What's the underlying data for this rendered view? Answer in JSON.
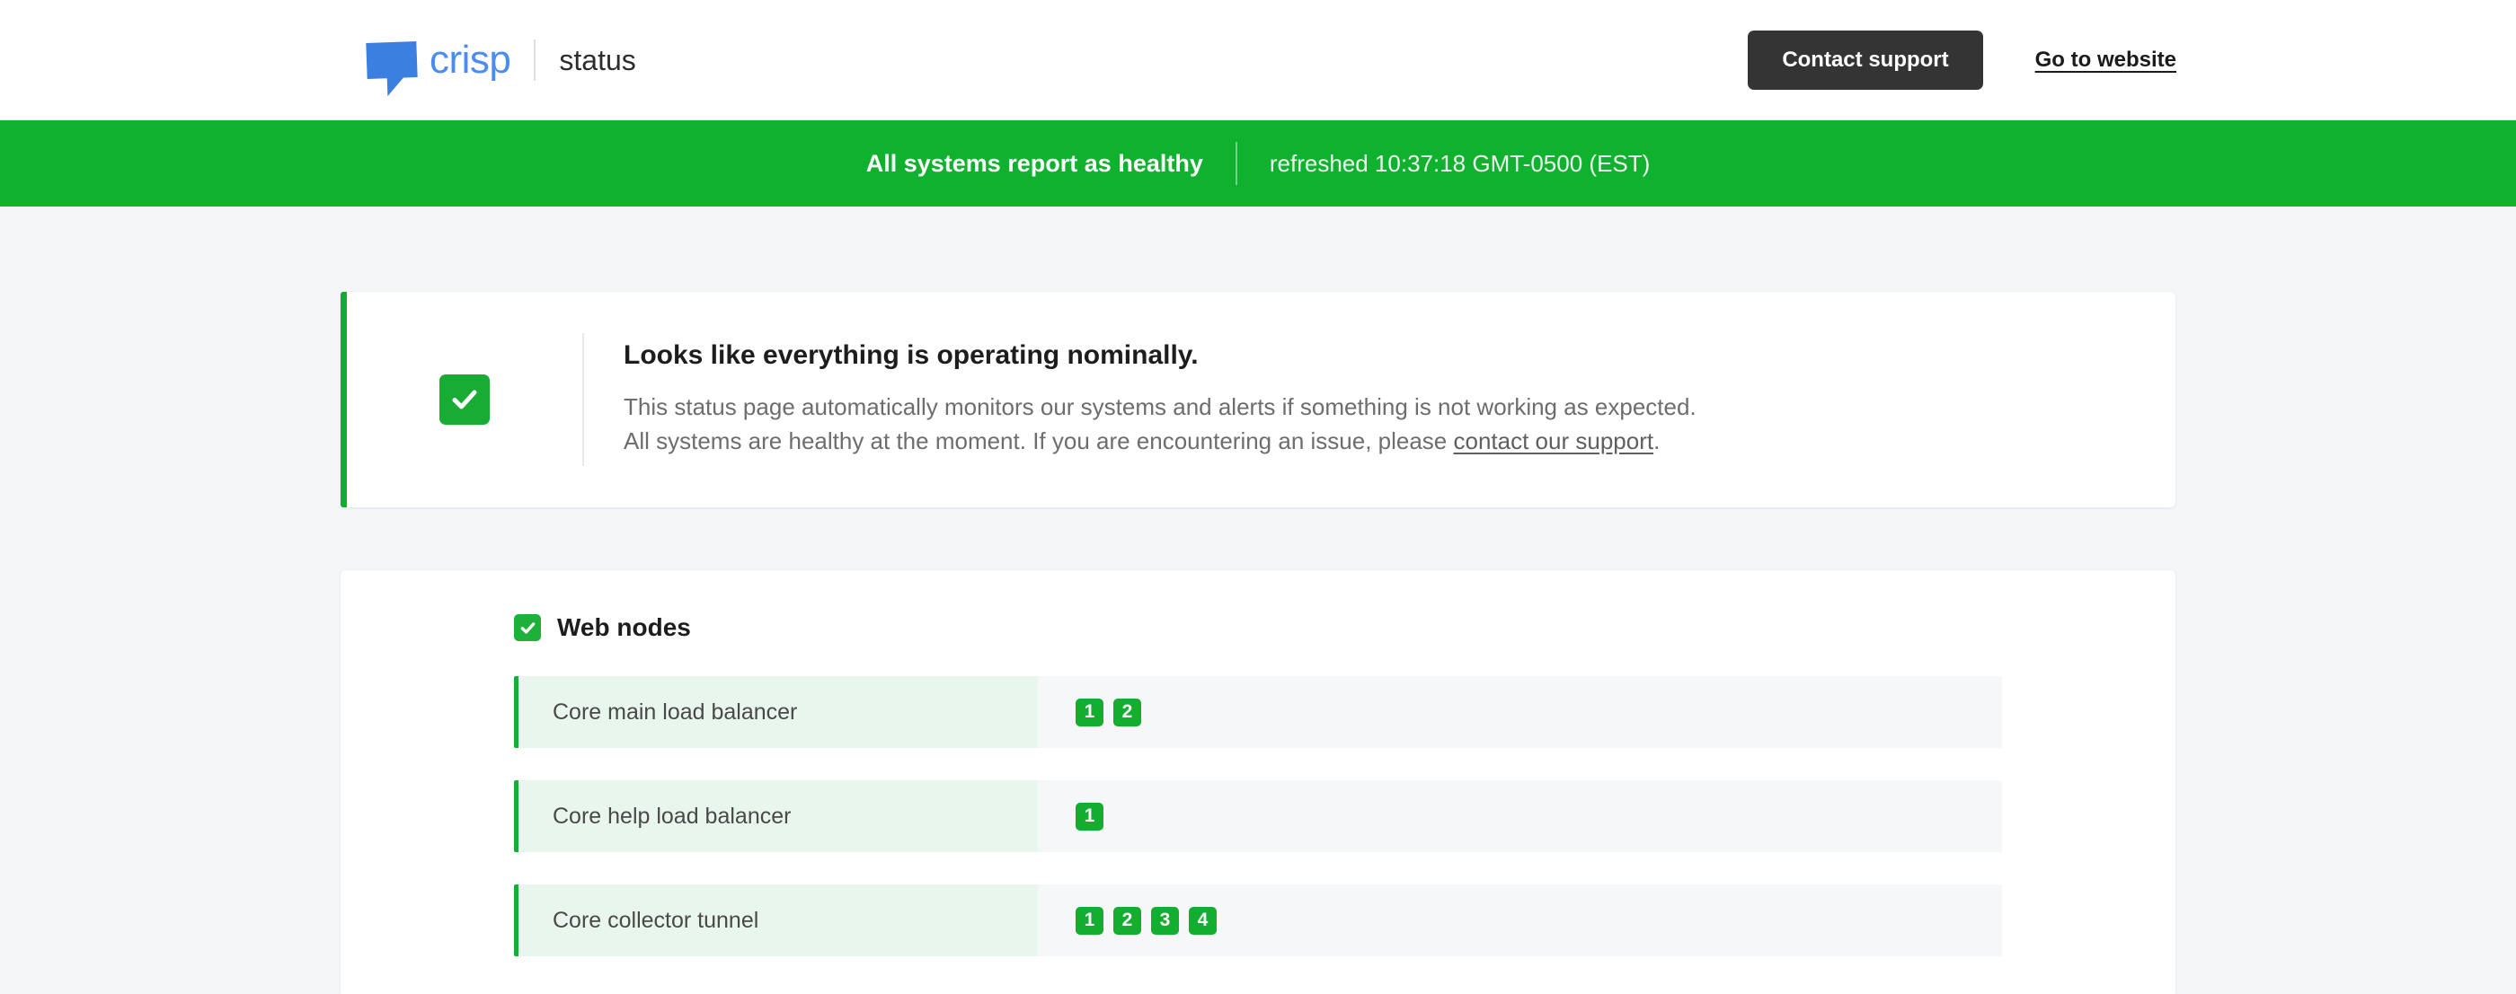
{
  "header": {
    "logo_word": "crisp",
    "logo_icon": "speech-bubble-icon",
    "sub_label": "status",
    "support_button": "Contact support",
    "website_link": "Go to website",
    "accent_blue": "#4a8cf0"
  },
  "banner": {
    "headline": "All systems report as healthy",
    "refreshed": "refreshed 10:37:18 GMT-0500 (EST)",
    "background": "#10b12e"
  },
  "status_card": {
    "icon": "check-icon",
    "title": "Looks like everything is operating nominally.",
    "line1": "This status page automatically monitors our systems and alerts if something is not working as expected.",
    "line2_before": "All systems are healthy at the moment. If you are encountering an issue, please ",
    "line2_link": "contact our support",
    "line2_after": ".",
    "accent": "#11ae2d"
  },
  "nodes_section": {
    "icon": "check-icon",
    "title": "Web nodes",
    "rows": [
      {
        "label": "Core main load balancer",
        "badges": [
          "1",
          "2"
        ]
      },
      {
        "label": "Core help load balancer",
        "badges": [
          "1"
        ]
      },
      {
        "label": "Core collector tunnel",
        "badges": [
          "1",
          "2",
          "3",
          "4"
        ]
      }
    ],
    "status_color": "#13ad30"
  }
}
